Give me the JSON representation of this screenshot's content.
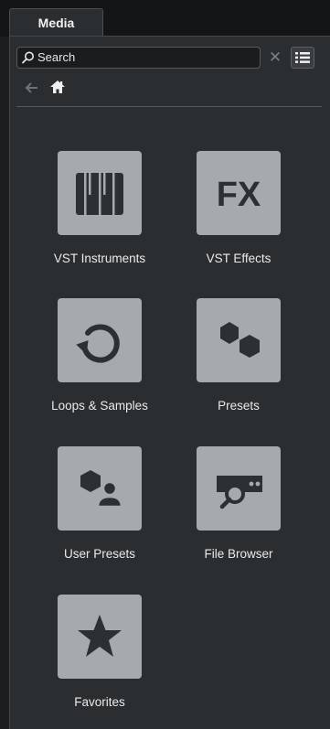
{
  "tab": {
    "label": "Media"
  },
  "search": {
    "placeholder": "Search"
  },
  "nav": {
    "back": "back",
    "home": "home"
  },
  "tiles": [
    {
      "label": "VST Instruments",
      "icon": "piano-keys-icon"
    },
    {
      "label": "VST Effects",
      "icon": "fx-icon",
      "glyph": "FX"
    },
    {
      "label": "Loops & Samples",
      "icon": "loop-icon"
    },
    {
      "label": "Presets",
      "icon": "presets-icon"
    },
    {
      "label": "User Presets",
      "icon": "user-presets-icon"
    },
    {
      "label": "File Browser",
      "icon": "file-browser-icon"
    },
    {
      "label": "Favorites",
      "icon": "star-icon"
    }
  ]
}
